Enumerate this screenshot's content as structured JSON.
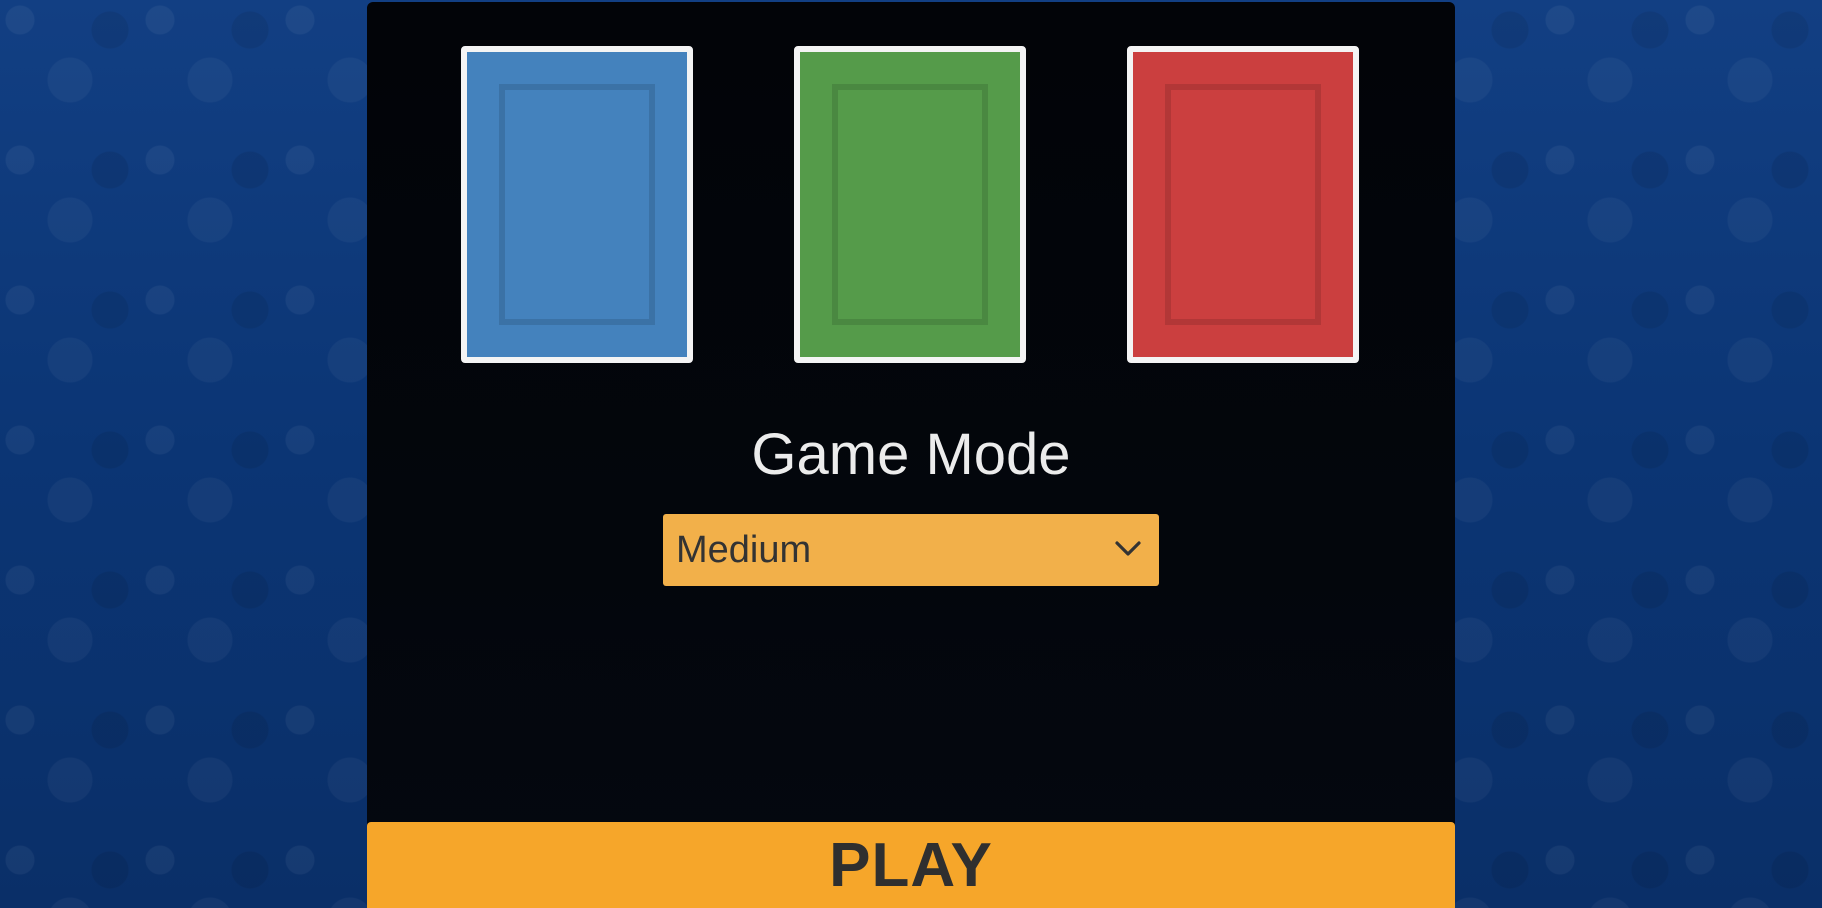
{
  "card_backs": [
    {
      "name": "blue",
      "color": "#4482bd"
    },
    {
      "name": "green",
      "color": "#559b4a"
    },
    {
      "name": "red",
      "color": "#cb3f3f"
    }
  ],
  "game_mode": {
    "title": "Game Mode",
    "selected": "Medium",
    "dropdown_color": "#f2b04a"
  },
  "play_button": {
    "label": "PLAY",
    "color": "#f6a62a"
  },
  "icons": {
    "dropdown": "chevron-down-icon"
  },
  "colors": {
    "background": "#0e3a7a",
    "panel": "#03060c"
  }
}
